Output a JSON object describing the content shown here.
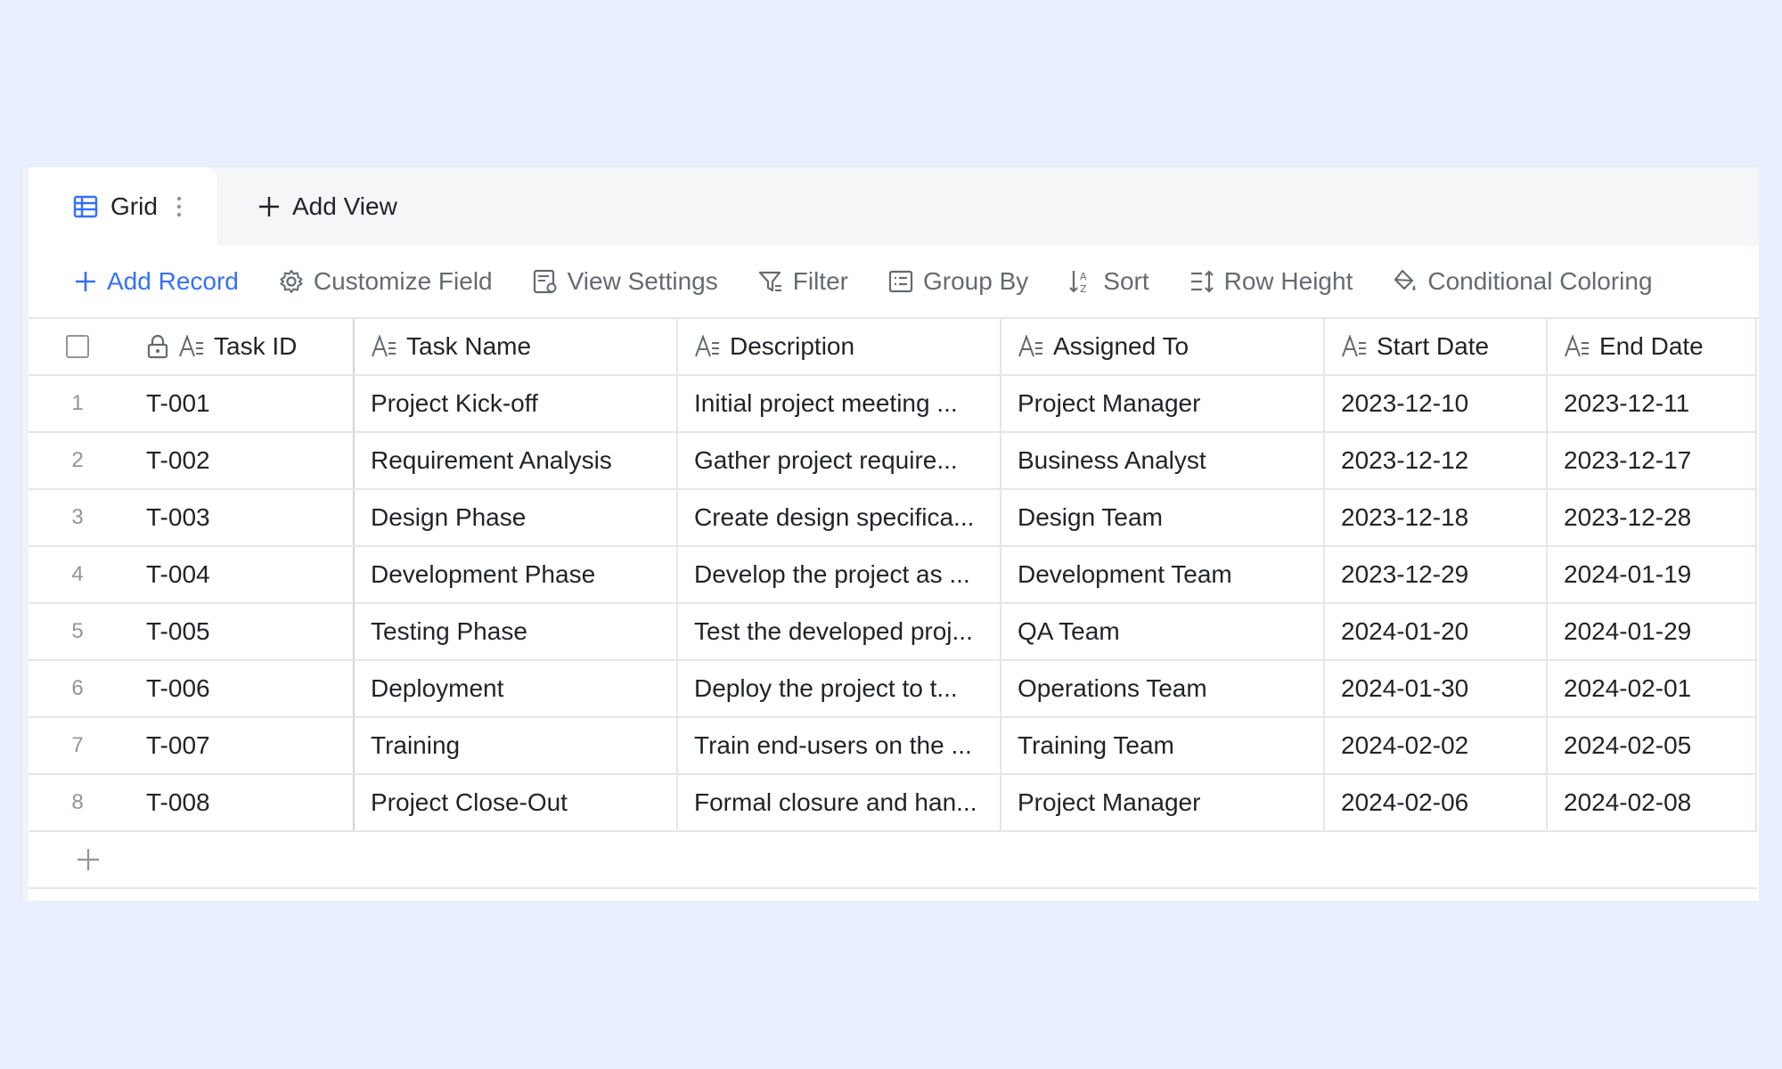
{
  "tabs": {
    "active": {
      "label": "Grid"
    },
    "add_view_label": "Add View"
  },
  "toolbar": {
    "add_record": "Add Record",
    "customize_field": "Customize Field",
    "view_settings": "View Settings",
    "filter": "Filter",
    "group_by": "Group By",
    "sort": "Sort",
    "row_height": "Row Height",
    "conditional_coloring": "Conditional Coloring"
  },
  "table": {
    "columns": [
      "Task ID",
      "Task Name",
      "Description",
      "Assigned To",
      "Start Date",
      "End Date"
    ],
    "rows": [
      {
        "index": "1",
        "id": "T-001",
        "name": "Project Kick-off",
        "description": "Initial project meeting ...",
        "assigned": "Project Manager",
        "start": "2023-12-10",
        "end": "2023-12-11"
      },
      {
        "index": "2",
        "id": "T-002",
        "name": "Requirement Analysis",
        "description": "Gather project require...",
        "assigned": "Business Analyst",
        "start": "2023-12-12",
        "end": "2023-12-17"
      },
      {
        "index": "3",
        "id": "T-003",
        "name": "Design Phase",
        "description": "Create design specifica...",
        "assigned": "Design Team",
        "start": "2023-12-18",
        "end": "2023-12-28"
      },
      {
        "index": "4",
        "id": "T-004",
        "name": "Development Phase",
        "description": "Develop the project as ...",
        "assigned": "Development Team",
        "start": "2023-12-29",
        "end": "2024-01-19"
      },
      {
        "index": "5",
        "id": "T-005",
        "name": "Testing Phase",
        "description": "Test the developed proj...",
        "assigned": "QA Team",
        "start": "2024-01-20",
        "end": "2024-01-29"
      },
      {
        "index": "6",
        "id": "T-006",
        "name": "Deployment",
        "description": "Deploy the project to t...",
        "assigned": "Operations Team",
        "start": "2024-01-30",
        "end": "2024-02-01"
      },
      {
        "index": "7",
        "id": "T-007",
        "name": "Training",
        "description": "Train end-users on the ...",
        "assigned": "Training Team",
        "start": "2024-02-02",
        "end": "2024-02-05"
      },
      {
        "index": "8",
        "id": "T-008",
        "name": "Project Close-Out",
        "description": "Formal closure and han...",
        "assigned": "Project Manager",
        "start": "2024-02-06",
        "end": "2024-02-08"
      }
    ]
  },
  "colors": {
    "background": "#e9effd",
    "accent": "#3370ff",
    "muted_text": "#646a73",
    "border": "#e5e6eb"
  }
}
